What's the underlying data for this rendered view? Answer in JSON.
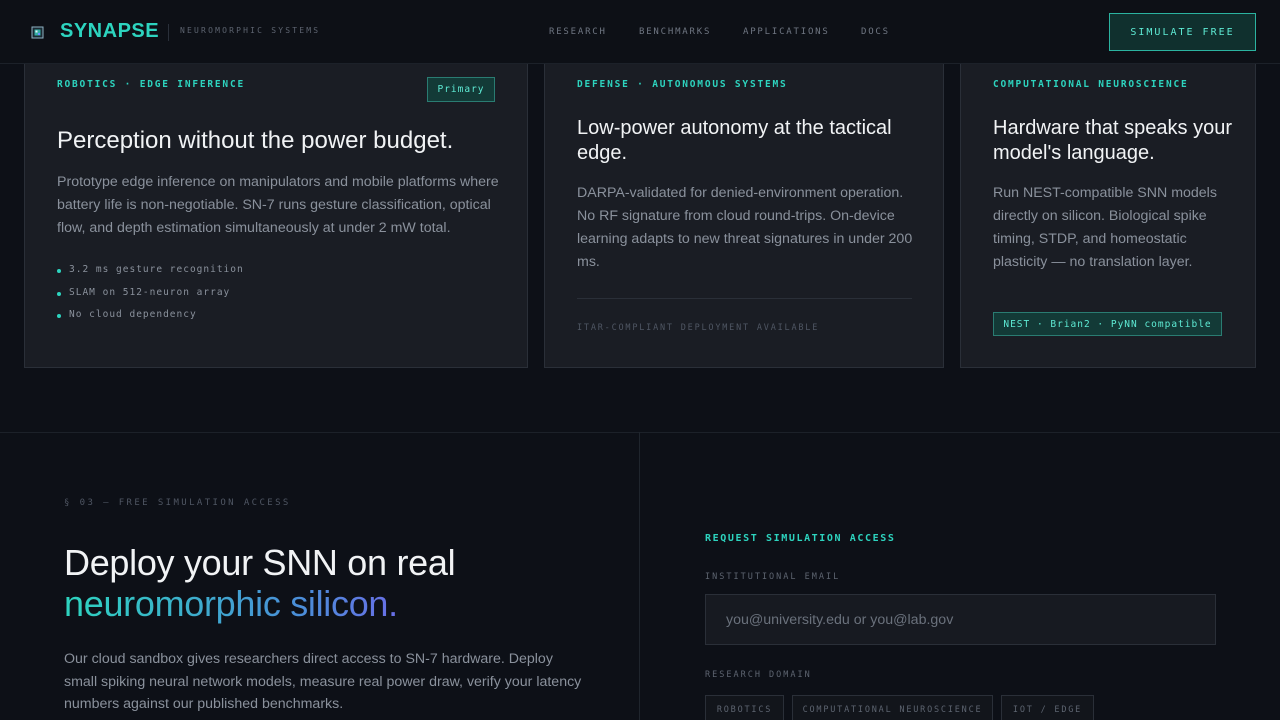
{
  "header": {
    "logo_icon": "chip-icon",
    "brand": "SYNAPSE",
    "tagline": "NEUROMORPHIC SYSTEMS",
    "nav": [
      "RESEARCH",
      "BENCHMARKS",
      "APPLICATIONS",
      "DOCS"
    ],
    "cta": "SIMULATE FREE"
  },
  "cards": [
    {
      "tag": "ROBOTICS · EDGE INFERENCE",
      "badge": "Primary",
      "title": "Perception without the power budget.",
      "body": "Prototype edge inference on manipulators and mobile platforms where battery life is non-negotiable. SN-7 runs gesture classification, optical flow, and depth estimation simultaneously at under 2 mW total.",
      "bullets": [
        "3.2 ms gesture recognition",
        "SLAM on 512-neuron array",
        "No cloud dependency"
      ]
    },
    {
      "tag": "DEFENSE · AUTONOMOUS SYSTEMS",
      "title": "Low-power autonomy at the tactical edge.",
      "body": "DARPA-validated for denied-environment operation. No RF signature from cloud round-trips. On-device learning adapts to new threat signatures in under 200 ms.",
      "footer": "ITAR-COMPLIANT DEPLOYMENT AVAILABLE"
    },
    {
      "tag": "COMPUTATIONAL NEUROSCIENCE",
      "title": "Hardware that speaks your model's language.",
      "body": "Run NEST-compatible SNN models directly on silicon. Biological spike timing, STDP, and homeostatic plasticity — no translation layer.",
      "badge": "NEST · Brian2 · PyNN compatible"
    }
  ],
  "access": {
    "section_label": "§ 03 — FREE SIMULATION ACCESS",
    "headline_line1": "Deploy your SNN on real",
    "headline_line2": "neuromorphic silicon.",
    "body": "Our cloud sandbox gives researchers direct access to SN-7 hardware. Deploy small spiking neural network models, measure real power draw, verify your latency numbers against our published benchmarks."
  },
  "form": {
    "title": "REQUEST SIMULATION ACCESS",
    "email_label": "INSTITUTIONAL EMAIL",
    "email_placeholder": "you@university.edu or you@lab.gov",
    "email_value": "",
    "domain_label": "RESEARCH DOMAIN",
    "domain_options": [
      "ROBOTICS",
      "COMPUTATIONAL NEUROSCIENCE",
      "IOT / EDGE"
    ]
  },
  "colors": {
    "accent": "#2dd4bf",
    "background": "#0d1017",
    "card": "#1a1d24"
  }
}
